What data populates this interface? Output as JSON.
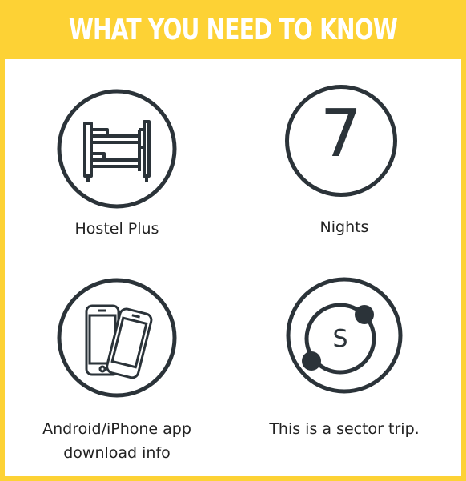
{
  "header": {
    "title": "WHAT YOU NEED TO KNOW"
  },
  "items": [
    {
      "label": "Hostel Plus",
      "icon": "bunk-bed-icon"
    },
    {
      "label": "Nights",
      "value": "7",
      "icon": "number-circle-icon"
    },
    {
      "label_line1": "Android/iPhone app",
      "label_line2": "download info",
      "icon": "smartphones-icon"
    },
    {
      "label": "This is a sector trip.",
      "letter": "S",
      "icon": "sector-trip-icon"
    }
  ],
  "colors": {
    "accent": "#fdd235",
    "icon_stroke": "#2b3339",
    "text": "#222222"
  }
}
